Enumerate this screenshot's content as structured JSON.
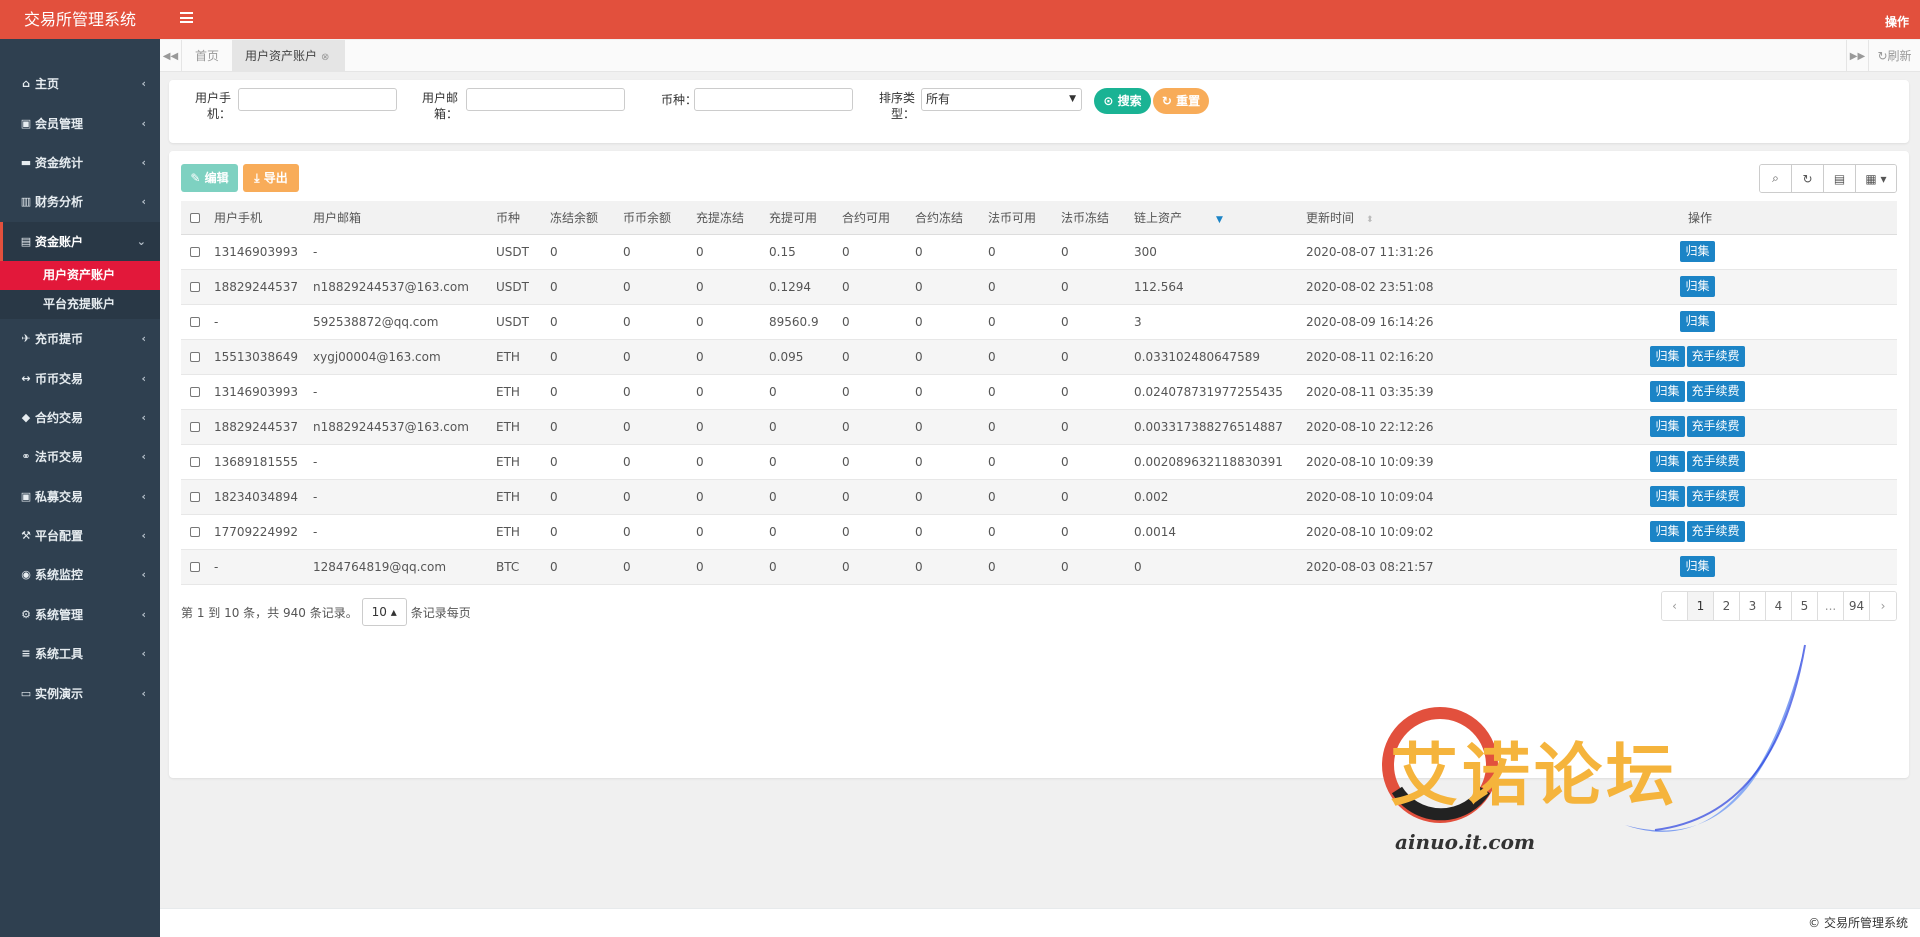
{
  "app": {
    "brand": "交易所管理系统",
    "top_right": "操作",
    "footer": "© 交易所管理系统"
  },
  "sidebar": {
    "items": [
      {
        "label": "主页",
        "icon": "home-icon",
        "glyph": "⌂"
      },
      {
        "label": "会员管理",
        "icon": "user-icon",
        "glyph": "▣"
      },
      {
        "label": "资金统计",
        "icon": "money-icon",
        "glyph": "▬"
      },
      {
        "label": "财务分析",
        "icon": "chart-icon",
        "glyph": "▥"
      },
      {
        "label": "资金账户",
        "icon": "calculator-icon",
        "glyph": "▤"
      },
      {
        "label": "充币提币",
        "icon": "plane-icon",
        "glyph": "✈"
      },
      {
        "label": "币币交易",
        "icon": "exchange-icon",
        "glyph": "↔"
      },
      {
        "label": "合约交易",
        "icon": "contract-icon",
        "glyph": "◆"
      },
      {
        "label": "法币交易",
        "icon": "handshake-icon",
        "glyph": "⚭"
      },
      {
        "label": "私募交易",
        "icon": "private-icon",
        "glyph": "▣"
      },
      {
        "label": "平台配置",
        "icon": "config-icon",
        "glyph": "⚒"
      },
      {
        "label": "系统监控",
        "icon": "monitor-icon",
        "glyph": "◉"
      },
      {
        "label": "系统管理",
        "icon": "gear-icon",
        "glyph": "⚙"
      },
      {
        "label": "系统工具",
        "icon": "tools-icon",
        "glyph": "≡"
      },
      {
        "label": "实例演示",
        "icon": "desktop-icon",
        "glyph": "▭"
      }
    ],
    "sub_items": [
      "用户资产账户",
      "平台充提账户"
    ]
  },
  "tabs": {
    "home": "首页",
    "current": "用户资产账户",
    "refresh": "刷新"
  },
  "search": {
    "phone_label": "用户手机：",
    "email_label": "用户邮箱：",
    "coin_label": "币种：",
    "sort_label": "排序类型：",
    "sort_value": "所有",
    "search_btn": "搜索",
    "reset_btn": "重置"
  },
  "toolbar": {
    "edit": "编辑",
    "export": "导出"
  },
  "table": {
    "headers": [
      "用户手机",
      "用户邮箱",
      "币种",
      "冻结余额",
      "币币余额",
      "充提冻结",
      "充提可用",
      "合约可用",
      "合约冻结",
      "法币可用",
      "法币冻结",
      "链上资产",
      "更新时间",
      "操作"
    ],
    "action_collect": "归集",
    "action_fee": "充手续费",
    "rows": [
      {
        "phone": "13146903993",
        "email": "-",
        "coin": "USDT",
        "frozen": "0",
        "bb": "0",
        "cz_frozen": "0",
        "cz_avail": "0.15",
        "hy_avail": "0",
        "hy_frozen": "0",
        "fb_avail": "0",
        "fb_frozen": "0",
        "chain": "300",
        "time": "2020-08-07 11:31:26",
        "fee": false
      },
      {
        "phone": "18829244537",
        "email": "n18829244537@163.com",
        "coin": "USDT",
        "frozen": "0",
        "bb": "0",
        "cz_frozen": "0",
        "cz_avail": "0.1294",
        "hy_avail": "0",
        "hy_frozen": "0",
        "fb_avail": "0",
        "fb_frozen": "0",
        "chain": "112.564",
        "time": "2020-08-02 23:51:08",
        "fee": false
      },
      {
        "phone": "-",
        "email": "592538872@qq.com",
        "coin": "USDT",
        "frozen": "0",
        "bb": "0",
        "cz_frozen": "0",
        "cz_avail": "89560.9",
        "hy_avail": "0",
        "hy_frozen": "0",
        "fb_avail": "0",
        "fb_frozen": "0",
        "chain": "3",
        "time": "2020-08-09 16:14:26",
        "fee": false
      },
      {
        "phone": "15513038649",
        "email": "xygj00004@163.com",
        "coin": "ETH",
        "frozen": "0",
        "bb": "0",
        "cz_frozen": "0",
        "cz_avail": "0.095",
        "hy_avail": "0",
        "hy_frozen": "0",
        "fb_avail": "0",
        "fb_frozen": "0",
        "chain": "0.033102480647589",
        "time": "2020-08-11 02:16:20",
        "fee": true
      },
      {
        "phone": "13146903993",
        "email": "-",
        "coin": "ETH",
        "frozen": "0",
        "bb": "0",
        "cz_frozen": "0",
        "cz_avail": "0",
        "hy_avail": "0",
        "hy_frozen": "0",
        "fb_avail": "0",
        "fb_frozen": "0",
        "chain": "0.024078731977255435",
        "time": "2020-08-11 03:35:39",
        "fee": true
      },
      {
        "phone": "18829244537",
        "email": "n18829244537@163.com",
        "coin": "ETH",
        "frozen": "0",
        "bb": "0",
        "cz_frozen": "0",
        "cz_avail": "0",
        "hy_avail": "0",
        "hy_frozen": "0",
        "fb_avail": "0",
        "fb_frozen": "0",
        "chain": "0.003317388276514887",
        "time": "2020-08-10 22:12:26",
        "fee": true
      },
      {
        "phone": "13689181555",
        "email": "-",
        "coin": "ETH",
        "frozen": "0",
        "bb": "0",
        "cz_frozen": "0",
        "cz_avail": "0",
        "hy_avail": "0",
        "hy_frozen": "0",
        "fb_avail": "0",
        "fb_frozen": "0",
        "chain": "0.002089632118830391",
        "time": "2020-08-10 10:09:39",
        "fee": true
      },
      {
        "phone": "18234034894",
        "email": "-",
        "coin": "ETH",
        "frozen": "0",
        "bb": "0",
        "cz_frozen": "0",
        "cz_avail": "0",
        "hy_avail": "0",
        "hy_frozen": "0",
        "fb_avail": "0",
        "fb_frozen": "0",
        "chain": "0.002",
        "time": "2020-08-10 10:09:04",
        "fee": true
      },
      {
        "phone": "17709224992",
        "email": "-",
        "coin": "ETH",
        "frozen": "0",
        "bb": "0",
        "cz_frozen": "0",
        "cz_avail": "0",
        "hy_avail": "0",
        "hy_frozen": "0",
        "fb_avail": "0",
        "fb_frozen": "0",
        "chain": "0.0014",
        "time": "2020-08-10 10:09:02",
        "fee": true
      },
      {
        "phone": "-",
        "email": "1284764819@qq.com",
        "coin": "BTC",
        "frozen": "0",
        "bb": "0",
        "cz_frozen": "0",
        "cz_avail": "0",
        "hy_avail": "0",
        "hy_frozen": "0",
        "fb_avail": "0",
        "fb_frozen": "0",
        "chain": "0",
        "time": "2020-08-03 08:21:57",
        "fee": false
      }
    ]
  },
  "pager": {
    "info_prefix": "第 1 到 10 条，共 940 条记录。",
    "page_size": "10",
    "info_suffix": "条记录每页",
    "pages": [
      "‹",
      "1",
      "2",
      "3",
      "4",
      "5",
      "...",
      "94",
      "›"
    ],
    "active_page": "1"
  },
  "watermark": {
    "text": "艾诺论坛",
    "url": "ainuo.it.com"
  },
  "colors": {
    "accent": "#e2503d",
    "sidebar": "#2f4050",
    "primary": "#1c84c6",
    "success": "#1ab394",
    "warning": "#f8ac59"
  }
}
